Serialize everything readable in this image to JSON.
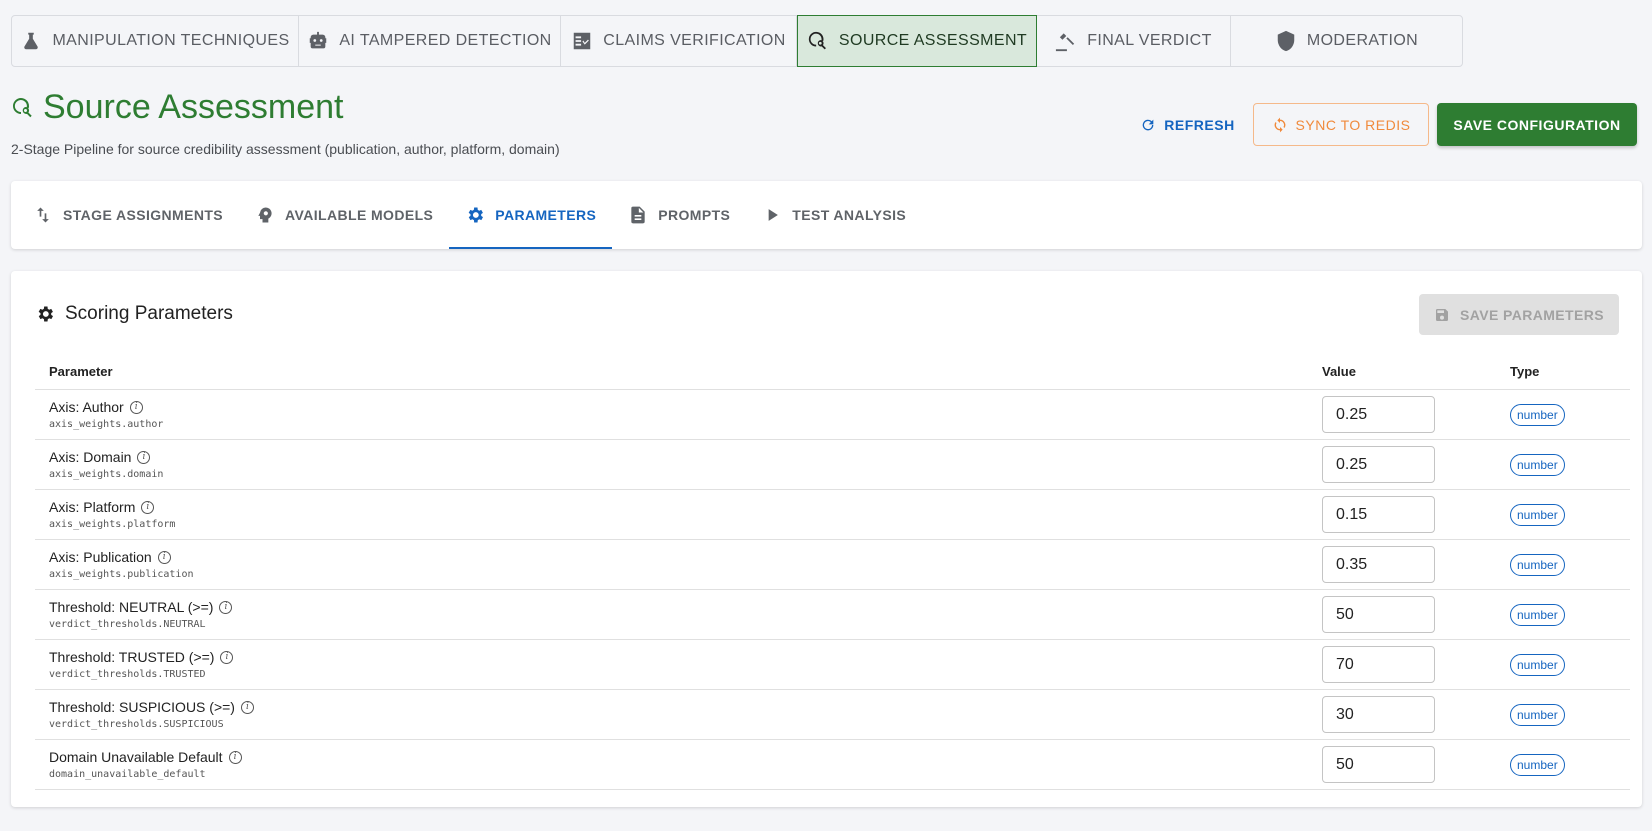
{
  "module_tabs": [
    {
      "label": "MANIPULATION TECHNIQUES",
      "icon": "flask-icon"
    },
    {
      "label": "AI TAMPERED DETECTION",
      "icon": "robot-icon"
    },
    {
      "label": "CLAIMS VERIFICATION",
      "icon": "fact-check-icon"
    },
    {
      "label": "SOURCE ASSESSMENT",
      "icon": "travel-explore-icon",
      "active": true
    },
    {
      "label": "FINAL VERDICT",
      "icon": "gavel-icon"
    },
    {
      "label": "MODERATION",
      "icon": "shield-icon"
    }
  ],
  "header": {
    "title": "Source Assessment",
    "subtitle": "2-Stage Pipeline for source credibility assessment (publication, author, platform, domain)",
    "refresh_label": "REFRESH",
    "sync_label": "SYNC TO REDIS",
    "save_config_label": "SAVE CONFIGURATION"
  },
  "sub_tabs": [
    {
      "label": "STAGE ASSIGNMENTS",
      "icon": "swap-vert-icon"
    },
    {
      "label": "AVAILABLE MODELS",
      "icon": "psychology-icon"
    },
    {
      "label": "PARAMETERS",
      "icon": "gear-icon",
      "active": true
    },
    {
      "label": "PROMPTS",
      "icon": "document-icon"
    },
    {
      "label": "TEST ANALYSIS",
      "icon": "play-icon"
    }
  ],
  "params": {
    "section_title": "Scoring Parameters",
    "save_label": "SAVE PARAMETERS",
    "columns": {
      "parameter": "Parameter",
      "value": "Value",
      "type": "Type"
    },
    "rows": [
      {
        "label": "Axis: Author",
        "key": "axis_weights.author",
        "value": "0.25",
        "type": "number"
      },
      {
        "label": "Axis: Domain",
        "key": "axis_weights.domain",
        "value": "0.25",
        "type": "number"
      },
      {
        "label": "Axis: Platform",
        "key": "axis_weights.platform",
        "value": "0.15",
        "type": "number"
      },
      {
        "label": "Axis: Publication",
        "key": "axis_weights.publication",
        "value": "0.35",
        "type": "number"
      },
      {
        "label": "Threshold: NEUTRAL (>=)",
        "key": "verdict_thresholds.NEUTRAL",
        "value": "50",
        "type": "number"
      },
      {
        "label": "Threshold: TRUSTED (>=)",
        "key": "verdict_thresholds.TRUSTED",
        "value": "70",
        "type": "number"
      },
      {
        "label": "Threshold: SUSPICIOUS (>=)",
        "key": "verdict_thresholds.SUSPICIOUS",
        "value": "30",
        "type": "number"
      },
      {
        "label": "Domain Unavailable Default",
        "key": "domain_unavailable_default",
        "value": "50",
        "type": "number"
      }
    ]
  },
  "colors": {
    "brand_green": "#2e7d32",
    "accent_blue": "#1565c0",
    "sync_orange": "#f08a3c"
  }
}
